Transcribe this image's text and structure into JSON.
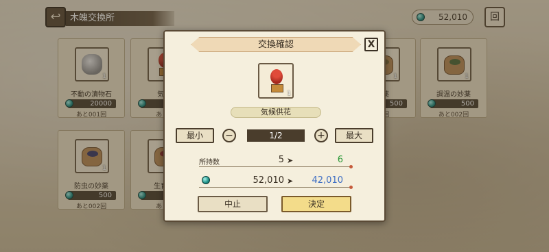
{
  "header": {
    "back_icon": "back-arrow-icon",
    "title": "木魄交換所",
    "currency_value": "52,010",
    "menu_label": "回"
  },
  "items": [
    {
      "name": "不動の漬物石",
      "price": "20000",
      "limit": "あと001回",
      "qty": "1"
    },
    {
      "name": "気候",
      "price": "",
      "limit": "あと0",
      "qty": "1"
    },
    {
      "name": "妙薬",
      "price": "500",
      "limit": "02回",
      "qty": "1"
    },
    {
      "name": "調温の妙薬",
      "price": "500",
      "limit": "あと002回",
      "qty": "1"
    },
    {
      "name": "防虫の妙薬",
      "price": "500",
      "limit": "あと002回",
      "qty": "1"
    },
    {
      "name": "生育の",
      "price": "",
      "limit": "あと0",
      "qty": "1"
    }
  ],
  "modal": {
    "title": "交換確認",
    "close_label": "X",
    "item_name": "気候供花",
    "item_qty": "1",
    "min_label": "最小",
    "max_label": "最大",
    "minus_label": "−",
    "plus_label": "+",
    "quantity_display": "1/2",
    "owned_label": "所持数",
    "owned_from": "5",
    "owned_to": "6",
    "gem_from": "52,010",
    "gem_to": "42,010",
    "arrow": "➤",
    "cancel_label": "中止",
    "confirm_label": "決定"
  },
  "colors": {
    "owned_to": "#2f9a3a",
    "gem_to": "#3f6fc4",
    "confirm_bg": "#f3dc8a"
  }
}
